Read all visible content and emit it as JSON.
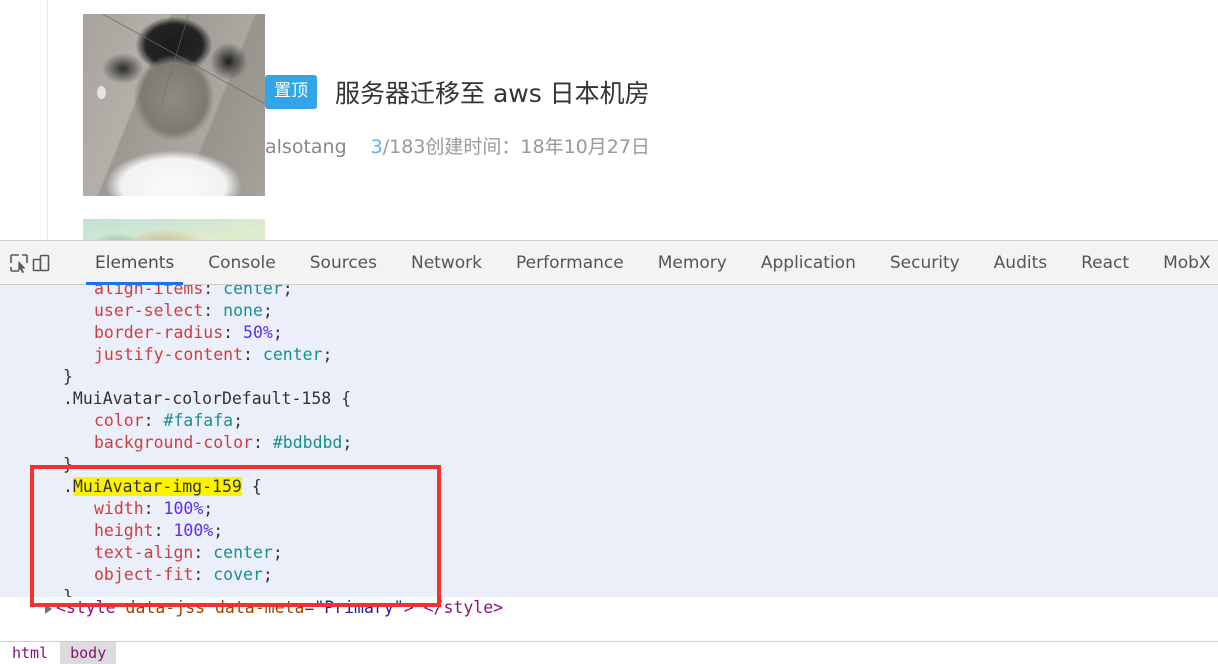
{
  "page": {
    "topic": {
      "badge": "置顶",
      "title": "服务器迁移至 aws 日本机房",
      "author": "alsotang",
      "reply_count": "3",
      "meta_rest": "/183创建时间：18年10月27日"
    }
  },
  "devtools": {
    "toolbar_icons": [
      {
        "name": "inspect-element-icon"
      },
      {
        "name": "device-toolbar-icon"
      }
    ],
    "tabs": [
      {
        "label": "Elements",
        "active": true
      },
      {
        "label": "Console",
        "active": false
      },
      {
        "label": "Sources",
        "active": false
      },
      {
        "label": "Network",
        "active": false
      },
      {
        "label": "Performance",
        "active": false
      },
      {
        "label": "Memory",
        "active": false
      },
      {
        "label": "Application",
        "active": false
      },
      {
        "label": "Security",
        "active": false
      },
      {
        "label": "Audits",
        "active": false
      },
      {
        "label": "React",
        "active": false
      },
      {
        "label": "MobX",
        "active": false
      }
    ],
    "styles": {
      "lines": [
        {
          "indent": 2,
          "property": "align-items",
          "value": "center",
          "kind": "decl",
          "clipped": true
        },
        {
          "indent": 2,
          "property": "user-select",
          "value": "none",
          "kind": "decl"
        },
        {
          "indent": 2,
          "property": "border-radius",
          "value": "50%",
          "kind": "decl-num"
        },
        {
          "indent": 2,
          "property": "justify-content",
          "value": "center",
          "kind": "decl"
        },
        {
          "indent": 1,
          "text": "}",
          "kind": "close"
        },
        {
          "indent": 1,
          "selector": ".MuiAvatar-colorDefault-158",
          "kind": "open"
        },
        {
          "indent": 2,
          "property": "color",
          "value": "#fafafa",
          "kind": "decl"
        },
        {
          "indent": 2,
          "property": "background-color",
          "value": "#bdbdbd",
          "kind": "decl"
        },
        {
          "indent": 1,
          "text": "}",
          "kind": "close"
        },
        {
          "indent": 1,
          "selector": ".MuiAvatar-img-159",
          "highlight": "MuiAvatar-img-159",
          "kind": "open"
        },
        {
          "indent": 2,
          "property": "width",
          "value": "100%",
          "kind": "decl-num"
        },
        {
          "indent": 2,
          "property": "height",
          "value": "100%",
          "kind": "decl-num"
        },
        {
          "indent": 2,
          "property": "text-align",
          "value": "center",
          "kind": "decl"
        },
        {
          "indent": 2,
          "property": "object-fit",
          "value": "cover",
          "kind": "decl"
        },
        {
          "indent": 1,
          "text": "}",
          "kind": "close"
        }
      ],
      "style_close_tag": "</style>",
      "next_node": {
        "open": "<style",
        "attr_name_1": "data-jss",
        "attr_name_2": "data-meta",
        "attr_value_2": "\"Primary\"",
        "open_end": ">",
        "ellipsis": " ",
        "close": "</style>"
      }
    },
    "breadcrumb": [
      {
        "label": "html",
        "selected": false
      },
      {
        "label": "body",
        "selected": true
      }
    ]
  },
  "annotation": {
    "name": "red-highlight-rectangle",
    "color": "#f4312f"
  },
  "colors": {
    "badge_blue": "#31a5e7",
    "link_blue": "#5ab6e8",
    "tab_active_underline": "#1a73e8",
    "styles_pane_bg": "#eaeffa",
    "highlight_yellow": "#fff200",
    "annotation_red": "#f4312f"
  }
}
